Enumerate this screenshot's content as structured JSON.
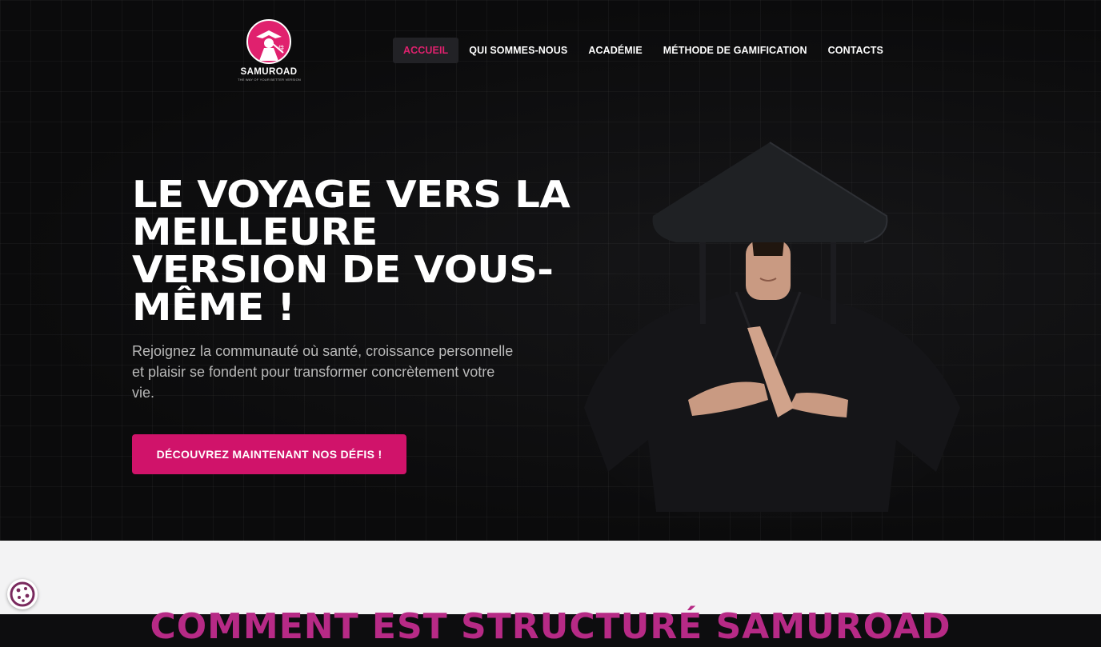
{
  "brand": {
    "name": "SAMUROAD",
    "tagline": "THE WAY OF YOUR BETTER VERSION",
    "accent": "#e0216e",
    "button_color": "#d0136a"
  },
  "nav": {
    "items": [
      {
        "label": "ACCUEIL",
        "active": true
      },
      {
        "label": "QUI SOMMES-NOUS",
        "active": false
      },
      {
        "label": "ACADÉMIE",
        "active": false
      },
      {
        "label": "MÉTHODE DE GAMIFICATION",
        "active": false
      },
      {
        "label": "CONTACTS",
        "active": false
      }
    ]
  },
  "hero": {
    "headline": "LE VOYAGE VERS LA MEILLEURE VERSION DE VOUS-MÊME !",
    "subtitle": "Rejoignez la communauté où santé, croissance personnelle et plaisir se fondent pour transformer concrètement votre vie.",
    "cta_label": "DÉCOUVREZ MAINTENANT NOS DÉFIS !",
    "image_icon": "samurai-photo"
  },
  "next_section": {
    "title": "COMMENT EST STRUCTURÉ SAMUROAD"
  },
  "cookie": {
    "icon": "cookie-icon"
  }
}
